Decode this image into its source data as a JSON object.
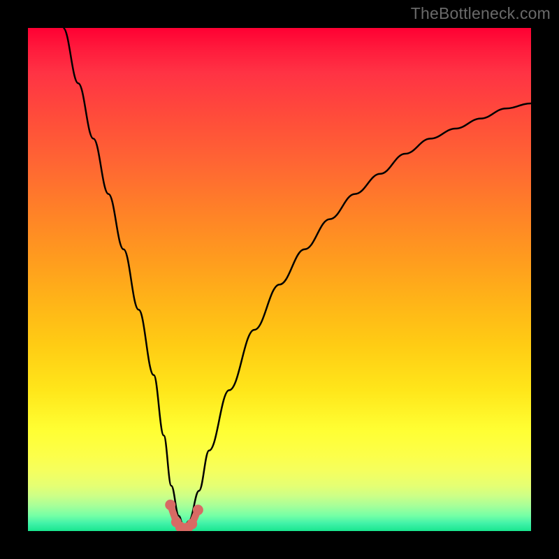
{
  "watermark": "TheBottleneck.com",
  "chart_data": {
    "type": "line",
    "title": "",
    "xlabel": "",
    "ylabel": "",
    "xlim": [
      0,
      100
    ],
    "ylim": [
      0,
      100
    ],
    "series": [
      {
        "name": "bottleneck-curve",
        "x": [
          7,
          10,
          13,
          16,
          19,
          22,
          25,
          27,
          28.5,
          30,
          31,
          32,
          34,
          36,
          40,
          45,
          50,
          55,
          60,
          65,
          70,
          75,
          80,
          85,
          90,
          95,
          100
        ],
        "y": [
          100,
          89,
          78,
          67,
          56,
          44,
          31,
          19,
          9,
          3,
          0.5,
          2,
          8,
          16,
          28,
          40,
          49,
          56,
          62,
          67,
          71,
          75,
          78,
          80,
          82,
          84,
          85
        ]
      }
    ],
    "optimal_zone": {
      "name": "optimal-markers",
      "x": [
        28.3,
        29.5,
        30.3,
        31,
        31.8,
        32.6,
        33.8
      ],
      "y": [
        5.2,
        1.8,
        0.8,
        0.5,
        0.7,
        1.4,
        4.2
      ]
    }
  }
}
